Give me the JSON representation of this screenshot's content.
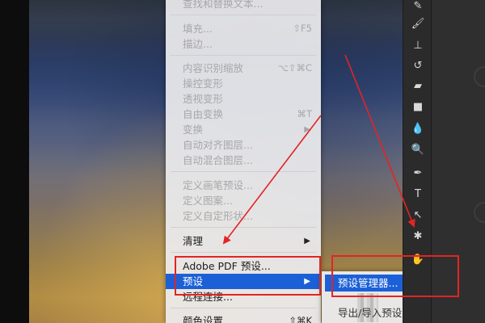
{
  "menu": {
    "items": [
      {
        "label": "查找和替换文本...",
        "shortcut": "",
        "disabled": true,
        "submenu": false
      },
      {
        "label": "填充...",
        "shortcut": "⇧F5",
        "disabled": true,
        "submenu": false
      },
      {
        "label": "描边...",
        "shortcut": "",
        "disabled": true,
        "submenu": false
      },
      {
        "label": "内容识别缩放",
        "shortcut": "⌥⇧⌘C",
        "disabled": true,
        "submenu": false
      },
      {
        "label": "操控变形",
        "shortcut": "",
        "disabled": true,
        "submenu": false
      },
      {
        "label": "透视变形",
        "shortcut": "",
        "disabled": true,
        "submenu": false
      },
      {
        "label": "自由变换",
        "shortcut": "⌘T",
        "disabled": true,
        "submenu": false
      },
      {
        "label": "变换",
        "shortcut": "",
        "disabled": true,
        "submenu": true
      },
      {
        "label": "自动对齐图层...",
        "shortcut": "",
        "disabled": true,
        "submenu": false
      },
      {
        "label": "自动混合图层...",
        "shortcut": "",
        "disabled": true,
        "submenu": false
      },
      {
        "label": "定义画笔预设...",
        "shortcut": "",
        "disabled": true,
        "submenu": false
      },
      {
        "label": "定义图案...",
        "shortcut": "",
        "disabled": true,
        "submenu": false
      },
      {
        "label": "定义自定形状...",
        "shortcut": "",
        "disabled": true,
        "submenu": false
      },
      {
        "label": "清理",
        "shortcut": "",
        "disabled": false,
        "submenu": true
      },
      {
        "label": "Adobe PDF 预设...",
        "shortcut": "",
        "disabled": false,
        "submenu": false
      },
      {
        "label": "预设",
        "shortcut": "",
        "disabled": false,
        "submenu": true,
        "highlighted": true
      },
      {
        "label": "远程连接...",
        "shortcut": "",
        "disabled": false,
        "submenu": false
      },
      {
        "label": "颜色设置...",
        "shortcut": "⇧⌘K",
        "disabled": false,
        "submenu": false
      }
    ],
    "arrow_glyph": "▶"
  },
  "submenu": {
    "items": [
      {
        "label": "预设管理器...",
        "highlighted": true
      },
      {
        "label": "导出/导入预设...",
        "highlighted": false
      }
    ]
  },
  "toolbar": {
    "tools": [
      "eraser-brush-icon",
      "brush-icon",
      "stamp-icon",
      "history-brush-icon",
      "eraser-icon",
      "gradient-icon",
      "blur-icon",
      "dodge-icon",
      "pen-icon",
      "type-icon",
      "path-select-icon",
      "custom-shape-icon",
      "hand-icon"
    ],
    "glyphs": [
      "✎",
      "🖌",
      "⊥",
      "↺",
      "▰",
      "■",
      "💧",
      "🔍",
      "✒",
      "T",
      "↖",
      "✱",
      "✋"
    ]
  },
  "colors": {
    "highlight": "#1c60d7",
    "annotation_red": "#e32424",
    "disabled_text": "#a7a7aa"
  }
}
